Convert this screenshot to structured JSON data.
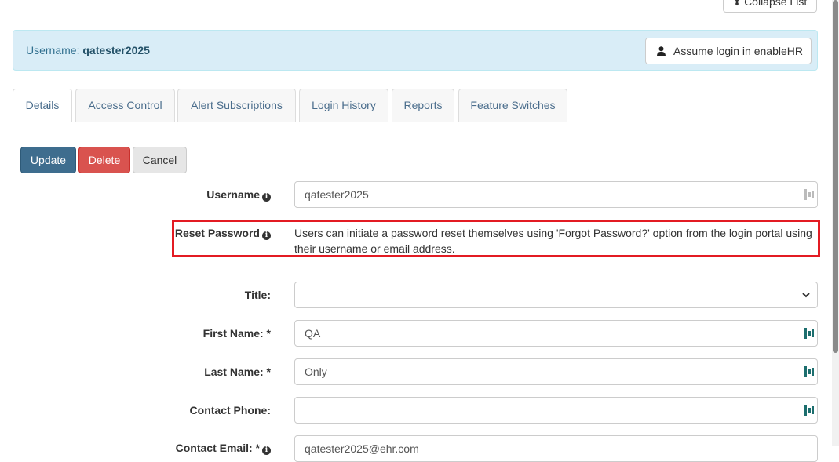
{
  "header": {
    "collapse_label": "Collapse List",
    "username_prefix": "Username:",
    "username_value": "qatester2025",
    "assume_label": "Assume login in enableHR"
  },
  "tabs": [
    {
      "label": "Details",
      "active": true
    },
    {
      "label": "Access Control"
    },
    {
      "label": "Alert Subscriptions"
    },
    {
      "label": "Login History"
    },
    {
      "label": "Reports"
    },
    {
      "label": "Feature Switches"
    }
  ],
  "actions": {
    "update": "Update",
    "delete": "Delete",
    "cancel": "Cancel"
  },
  "form": {
    "username": {
      "label": "Username",
      "value": "qatester2025"
    },
    "reset_password": {
      "label": "Reset Password",
      "text": "Users can initiate a password reset themselves using 'Forgot Password?' option from the login portal using their username or email address."
    },
    "title": {
      "label": "Title:",
      "value": ""
    },
    "first_name": {
      "label": "First Name: *",
      "value": "QA"
    },
    "last_name": {
      "label": "Last Name: *",
      "value": "Only"
    },
    "contact_phone": {
      "label": "Contact Phone:",
      "value": ""
    },
    "contact_email": {
      "label": "Contact Email: *",
      "value": "qatester2025@ehr.com"
    }
  },
  "colors": {
    "highlight": "#e31b23",
    "primary": "#3e6d8e",
    "danger": "#d9534f",
    "banner": "#d9edf7"
  }
}
